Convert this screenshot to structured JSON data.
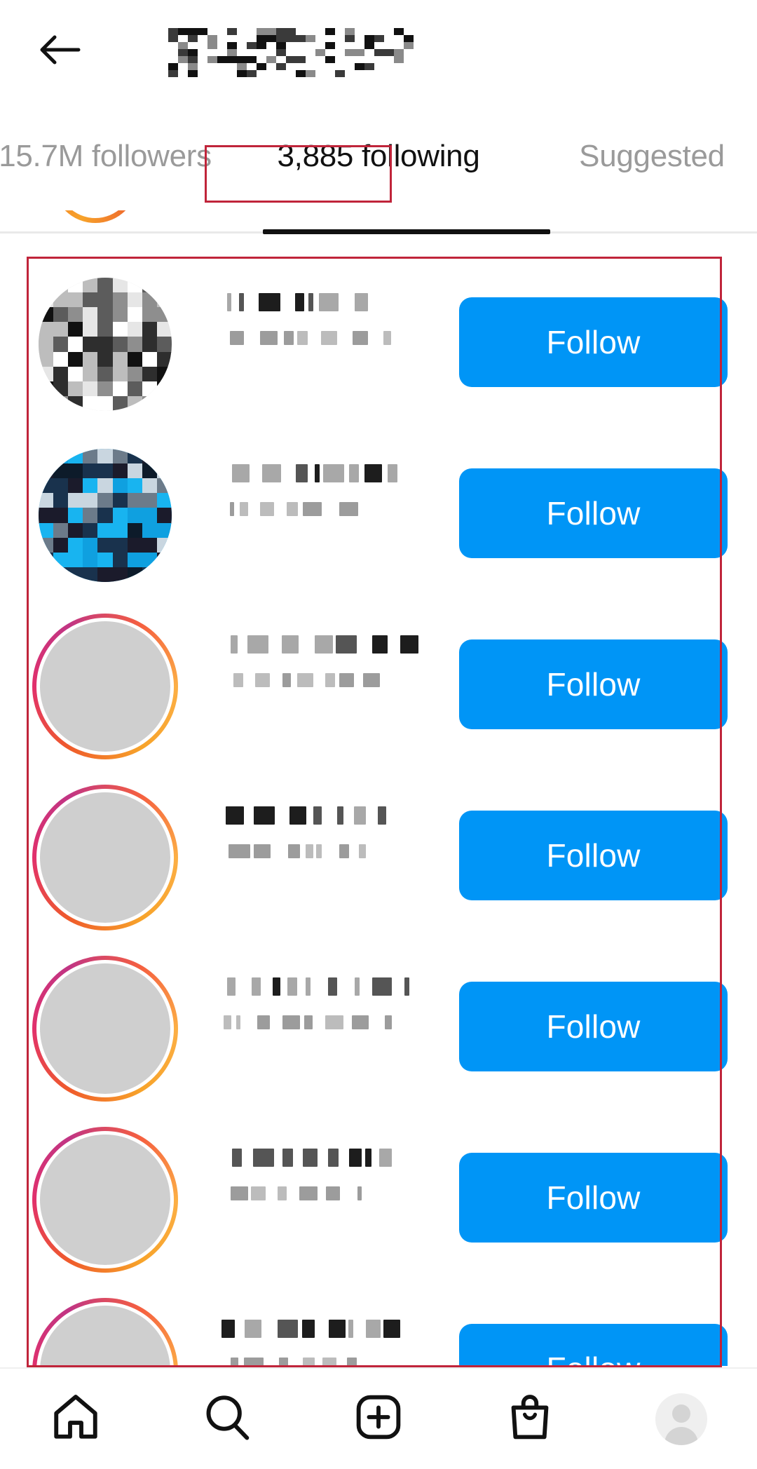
{
  "header": {
    "back_icon": "back-arrow-icon",
    "title": "[redacted username]",
    "title_redacted": true
  },
  "tabs": [
    {
      "label": "15.7M followers",
      "active": false
    },
    {
      "label": "3,885 following",
      "active": true
    },
    {
      "label": "Suggested",
      "active": false
    }
  ],
  "annotations": [
    {
      "name": "tab-highlight-box",
      "color": "#c0243a",
      "target": "3,885 following"
    },
    {
      "name": "list-highlight-box",
      "color": "#c0243a",
      "target": "following list"
    }
  ],
  "accent_colors": {
    "follow_button": "#0095F6",
    "follow_button_text": "#ffffff",
    "annotation": "#c0243a",
    "active_tab_text": "#111111",
    "inactive_tab_text": "#9a9a9a",
    "divider": "#e9e9e9"
  },
  "list": {
    "rows": [
      {
        "username": "[redacted]",
        "subtitle": "[redacted]",
        "action_label": "Follow",
        "has_story_ring": false,
        "avatar_tone": "grayscale"
      },
      {
        "username": "[redacted]",
        "subtitle": "[redacted]",
        "action_label": "Follow",
        "has_story_ring": false,
        "avatar_tone": "cyan"
      },
      {
        "username": "[redacted]",
        "subtitle": "[redacted]",
        "action_label": "Follow",
        "has_story_ring": true,
        "avatar_tone": "warm"
      },
      {
        "username": "[redacted]",
        "subtitle": "[redacted]",
        "action_label": "Follow",
        "has_story_ring": true,
        "avatar_tone": "light"
      },
      {
        "username": "[redacted]",
        "subtitle": "[redacted]",
        "action_label": "Follow",
        "has_story_ring": true,
        "avatar_tone": "olive"
      },
      {
        "username": "[redacted]",
        "subtitle": "[redacted]",
        "action_label": "Follow",
        "has_story_ring": true,
        "avatar_tone": "dark"
      },
      {
        "username": "[redacted]",
        "subtitle": "[redacted]",
        "action_label": "Follow",
        "has_story_ring": true,
        "avatar_tone": "black"
      }
    ]
  },
  "bottom_nav": [
    {
      "icon": "home-icon",
      "label": "Home"
    },
    {
      "icon": "search-icon",
      "label": "Search"
    },
    {
      "icon": "create-icon",
      "label": "Create"
    },
    {
      "icon": "shop-icon",
      "label": "Shop"
    },
    {
      "icon": "profile-avatar-icon",
      "label": "Profile"
    }
  ]
}
